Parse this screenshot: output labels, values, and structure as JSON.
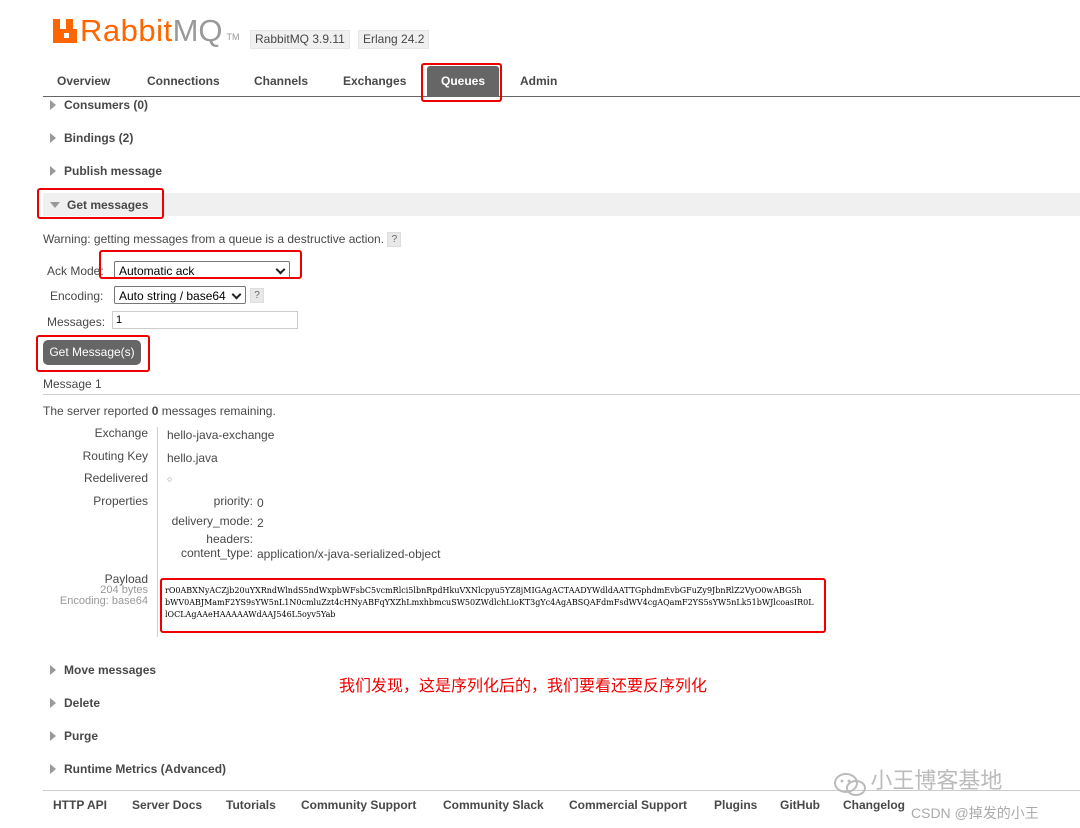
{
  "header": {
    "logo_brand": "Rabbit",
    "logo_suffix": "MQ",
    "logo_tm": "TM",
    "version_rabbit": "RabbitMQ 3.9.11",
    "version_erlang": "Erlang 24.2"
  },
  "nav": {
    "tabs": [
      "Overview",
      "Connections",
      "Channels",
      "Exchanges",
      "Queues",
      "Admin"
    ],
    "active": "Queues"
  },
  "sections": {
    "consumers": "Consumers (0)",
    "bindings": "Bindings (2)",
    "publish": "Publish message",
    "get": "Get messages",
    "move": "Move messages",
    "delete": "Delete",
    "purge": "Purge",
    "runtime": "Runtime Metrics (Advanced)"
  },
  "get_form": {
    "warning": "Warning: getting messages from a queue is a destructive action.",
    "help": "?",
    "ack_label": "Ack Mode:",
    "ack_value": "Automatic ack",
    "encoding_label": "Encoding:",
    "encoding_value": "Auto string / base64",
    "messages_label": "Messages:",
    "messages_value": "1",
    "button": "Get Message(s)"
  },
  "result": {
    "message_title": "Message 1",
    "remaining_prefix": "The server reported ",
    "remaining_count": "0",
    "remaining_suffix": " messages remaining.",
    "exchange_label": "Exchange",
    "exchange_value": "hello-java-exchange",
    "routing_label": "Routing Key",
    "routing_value": "hello.java",
    "redelivered_label": "Redelivered",
    "redelivered_value": "○",
    "properties_label": "Properties",
    "priority_key": "priority:",
    "priority_value": "0",
    "delivery_key": "delivery_mode:",
    "delivery_value": "2",
    "headers_key": "headers:",
    "content_type_key": "content_type:",
    "content_type_value": "application/x-java-serialized-object",
    "payload_label": "Payload",
    "payload_bytes": "204 bytes",
    "payload_encoding": "Encoding: base64",
    "payload_line1": "rO0ABXNyACZjb20uYXRndWlndS5ndWxpbWFsbC5vcmRlci5lbnRpdHkuVXNlcpyu5YZ8jMIGAgACTAADYWdldAATTGphdmEvbGFuZy9JbnRlZ2VyO0wABG5h",
    "payload_line2": "bWV0ABJMamF2YS9sYW5nL1N0cmluZzt4cHNyABFqYXZhLmxhbmcuSW50ZWdlchLioKT3gYc4AgABSQAFdmFsdWV4cgAQamF2YS5sYW5nLk51bWJlcoasIR0L",
    "payload_line3": "lOCLAgAAeHAAAAAWdAAJ546L5oyv5Yab"
  },
  "annotation": "我们发现，这是序列化后的，我们要看还要反序列化",
  "footer": {
    "links": [
      "HTTP API",
      "Server Docs",
      "Tutorials",
      "Community Support",
      "Community Slack",
      "Commercial Support",
      "Plugins",
      "GitHub",
      "Changelog"
    ]
  },
  "watermark": {
    "wechat": "小王博客基地",
    "csdn": "CSDN @掉发的小王"
  },
  "colors": {
    "brand_orange": "#ff6600",
    "tab_active": "#666666",
    "highlight_red": "#ee0000"
  }
}
